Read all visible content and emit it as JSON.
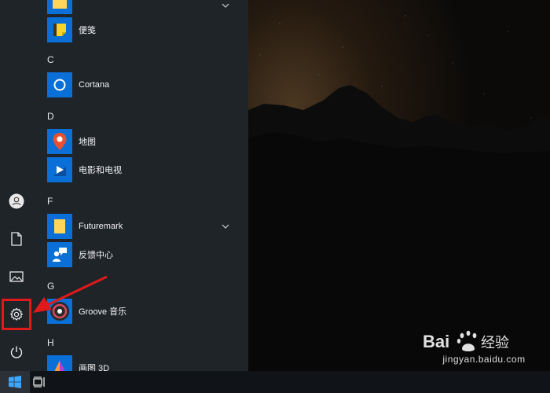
{
  "start_menu": {
    "rail": {
      "items": [
        {
          "name": "account",
          "icon": "user-icon"
        },
        {
          "name": "documents",
          "icon": "document-icon"
        },
        {
          "name": "pictures",
          "icon": "picture-icon"
        },
        {
          "name": "settings",
          "icon": "gear-icon"
        },
        {
          "name": "power",
          "icon": "power-icon"
        }
      ]
    },
    "app_list": {
      "sections": [
        {
          "letter": "",
          "apps": [
            {
              "label": "",
              "icon": "folder-icon",
              "tile_color": "#0a6fd6",
              "has_chevron": true
            },
            {
              "label": "便笺",
              "icon": "sticky-note-icon",
              "tile_color": "#0a6fd6"
            }
          ]
        },
        {
          "letter": "C",
          "apps": [
            {
              "label": "Cortana",
              "icon": "cortana-icon",
              "tile_color": "#0a6fd6"
            }
          ]
        },
        {
          "letter": "D",
          "apps": [
            {
              "label": "地图",
              "icon": "map-pin-icon",
              "tile_color": "#0a6fd6"
            },
            {
              "label": "电影和电视",
              "icon": "play-icon",
              "tile_color": "#0a6fd6"
            }
          ]
        },
        {
          "letter": "F",
          "apps": [
            {
              "label": "Futuremark",
              "icon": "folder-icon",
              "tile_color": "#0a6fd6",
              "has_chevron": true
            },
            {
              "label": "反馈中心",
              "icon": "feedback-icon",
              "tile_color": "#0a6fd6"
            }
          ]
        },
        {
          "letter": "G",
          "apps": [
            {
              "label": "Groove 音乐",
              "icon": "groove-icon",
              "tile_color": "#0a6fd6"
            }
          ]
        },
        {
          "letter": "H",
          "apps": [
            {
              "label": "画图 3D",
              "icon": "paint3d-icon",
              "tile_color": "#0a6fd6"
            }
          ]
        }
      ]
    }
  },
  "taskbar": {
    "start_icon": "windows-logo-icon",
    "task_view_icon": "task-view-icon"
  },
  "annotation": {
    "color": "#e0191b",
    "target": "settings"
  },
  "watermark": {
    "brand_line": "Bai 经验",
    "url": "jingyan.baidu.com"
  },
  "colors": {
    "start_menu_bg": "#1f2429",
    "taskbar_bg": "#101418",
    "accent": "#0a6fd6"
  }
}
